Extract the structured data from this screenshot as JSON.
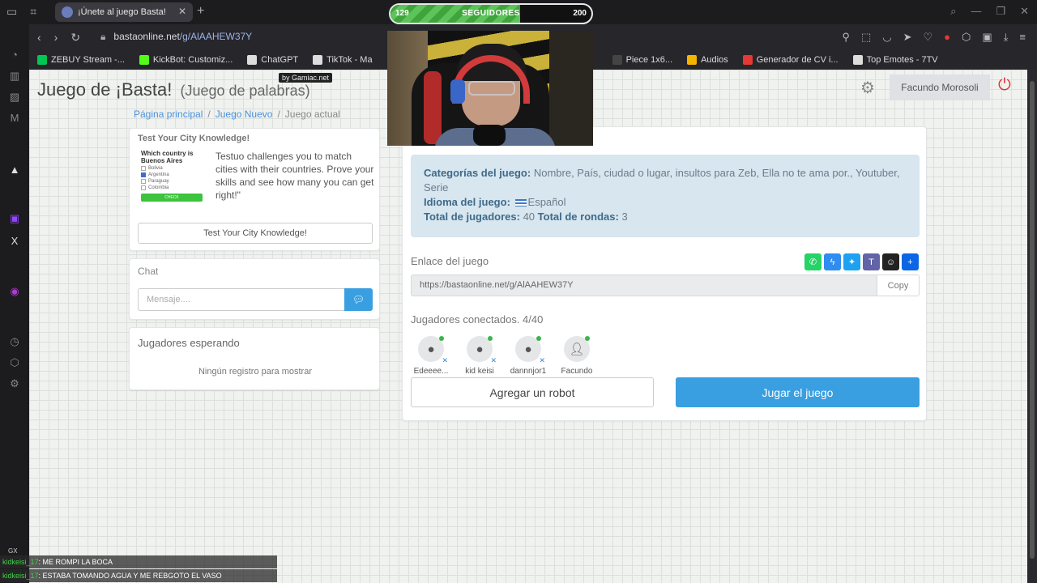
{
  "browser": {
    "tab_title": "¡Únete al juego Basta!",
    "url_host": "bastaonline.net",
    "url_path": "/g/AlAAHEW37Y",
    "bookmarks": [
      {
        "label": "ZEBUY Stream -...",
        "color": "#00c853"
      },
      {
        "label": "KickBot: Customiz...",
        "color": "#53fc18"
      },
      {
        "label": "ChatGPT",
        "color": "#dddddd"
      },
      {
        "label": "TikTok - Ma",
        "color": "#dddddd"
      },
      {
        "label": "Piece 1x6...",
        "color": "#444444"
      },
      {
        "label": "Audios",
        "color": "#f5b400"
      },
      {
        "label": "Generador de CV i...",
        "color": "#e53935"
      },
      {
        "label": "Top Emotes - 7TV",
        "color": "#dddddd"
      }
    ]
  },
  "header": {
    "title": "Juego de ¡Basta!",
    "subtitle": "(Juego de palabras)",
    "user": "Facundo Morosoli",
    "gamiac": "by Gamiac.net"
  },
  "breadcrumb": {
    "home": "Página principal",
    "new_game": "Juego Nuevo",
    "current": "Juego actual"
  },
  "ad": {
    "title": "Test Your City Knowledge!",
    "question": "Which country is Buenos Aires",
    "options": [
      "Bolivia",
      "Argentina",
      "Paraguay",
      "Colombia"
    ],
    "check": "CHECK",
    "text": "Testuo challenges you to match cities with their countries. Prove your skills and see how many you can get right!\"",
    "button": "Test Your City Knowledge!"
  },
  "chat": {
    "title": "Chat",
    "placeholder": "Mensaje...."
  },
  "waiting": {
    "title": "Jugadores esperando",
    "empty": "Ningún registro para mostrar"
  },
  "game": {
    "categories_label": "Categorías del juego:",
    "categories_value": "Nombre, País, ciudad o lugar, insultos para Zeb, Ella no te ama por., Youtuber, Serie",
    "language_label": "Idioma del juego:",
    "language_value": "Español",
    "players_label": "Total de jugadores:",
    "players_value": "40",
    "rounds_label": "Total de rondas:",
    "rounds_value": "3",
    "link_label": "Enlace del juego",
    "link_value": "https://bastaonline.net/g/AlAAHEW37Y",
    "copy": "Copy",
    "connected": "Jugadores conectados. 4/40",
    "players": [
      "Edeeee...",
      "kid keisi",
      "dannnjor1",
      "Facundo"
    ],
    "robot_button": "Agregar un robot",
    "play_button": "Jugar el juego"
  },
  "overlay": {
    "followers_current": "129",
    "followers_label": "SEGUIDORES",
    "followers_goal": "200",
    "followers_progress": 0.645,
    "chat": [
      {
        "user": "kidkeisi_17",
        "msg": ": ME ROMPI LA BOCA"
      },
      {
        "user": "kidkeisi_17",
        "msg": ": ESTABA TOMANDO AGUA Y ME REBGOTO EL VASO"
      }
    ],
    "gx": "GX"
  },
  "colors": {
    "primary": "#3a9fe0",
    "info_bg": "#d7e6ef",
    "power": "#d9363e"
  }
}
